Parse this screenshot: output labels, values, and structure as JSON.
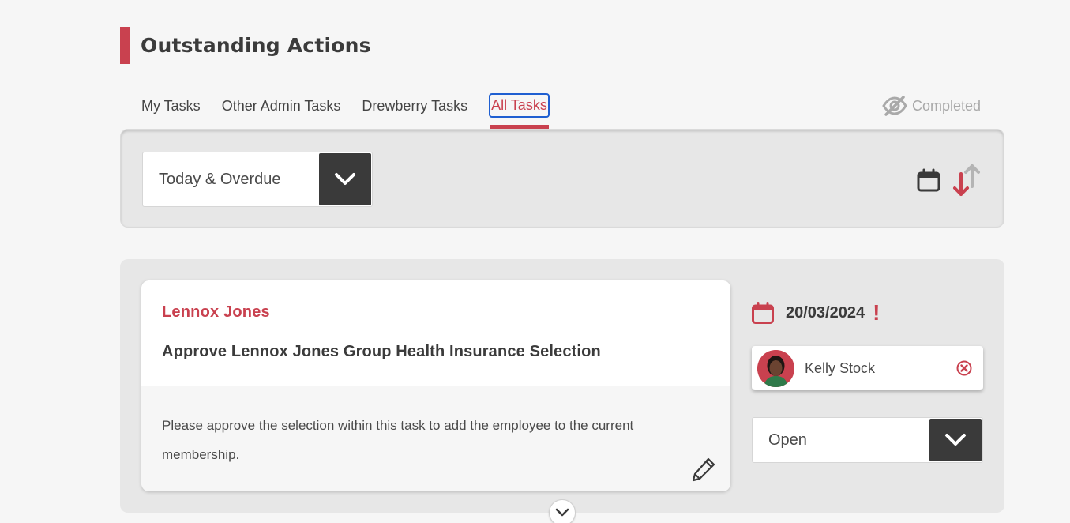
{
  "header": {
    "title": "Outstanding Actions"
  },
  "tabs": [
    {
      "label": "My Tasks",
      "active": false
    },
    {
      "label": "Other Admin Tasks",
      "active": false
    },
    {
      "label": "Drewberry Tasks",
      "active": false
    },
    {
      "label": "All Tasks",
      "active": true
    }
  ],
  "completed_toggle": {
    "label": "Completed",
    "icon": "eye-slash-icon"
  },
  "filter": {
    "selected": "Today & Overdue"
  },
  "sort": {
    "icon_calendar": "calendar-icon",
    "icon_sort": "sort-arrows-icon"
  },
  "task": {
    "person": "Lennox Jones",
    "title": "Approve Lennox Jones Group Health Insurance Selection",
    "description": "Please approve the selection within this task to add the employee to the current membership.",
    "due_date": "20/03/2024",
    "overdue_marker": "!",
    "assignee": "Kelly Stock",
    "status": "Open"
  },
  "colors": {
    "accent": "#c9414f",
    "dark": "#3a3a3a",
    "panel": "#e7e7e7",
    "focus": "#1f5fd1"
  }
}
